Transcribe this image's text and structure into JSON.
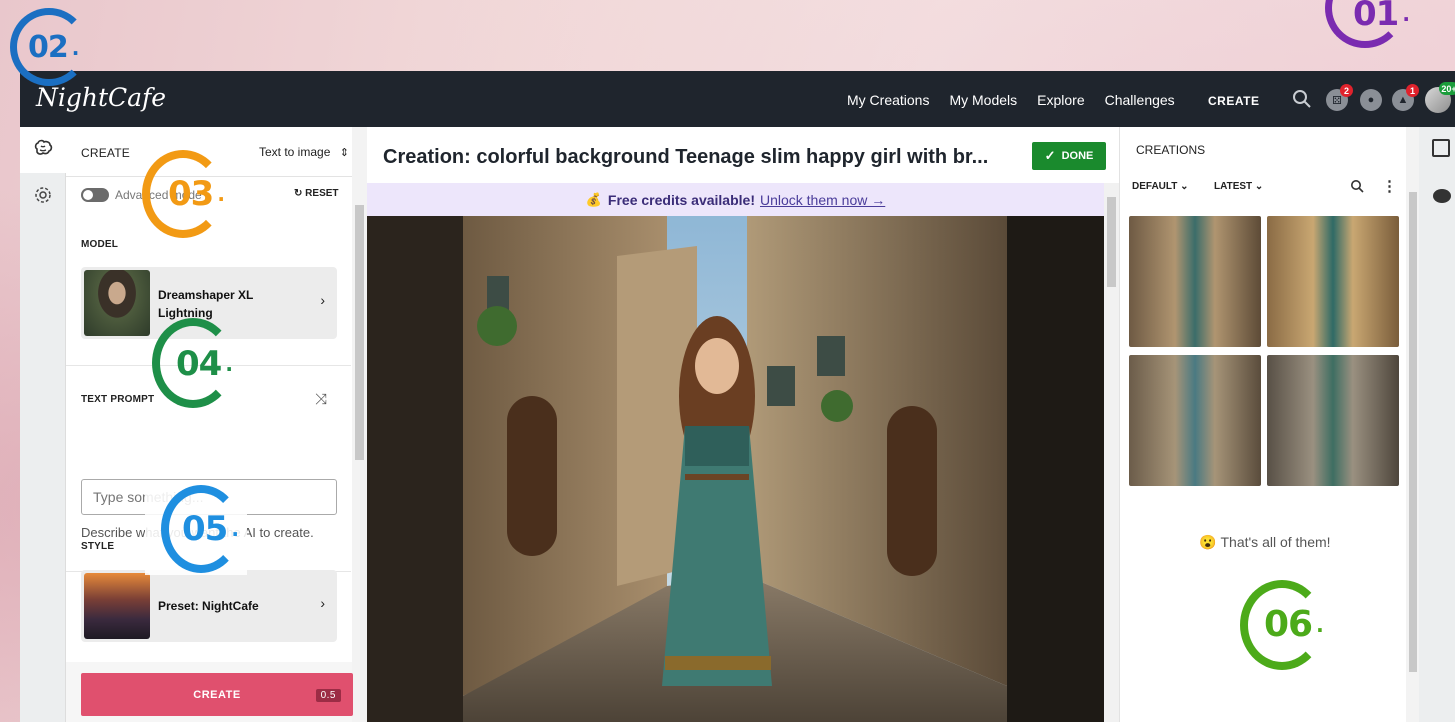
{
  "badges": [
    {
      "number": "02",
      "dot": ".",
      "color": "#1b6fc2"
    },
    {
      "number": "01",
      "dot": ".",
      "color": "#7a2bb0"
    },
    {
      "number": "03",
      "dot": ".",
      "color": "#f29a14"
    },
    {
      "number": "04",
      "dot": ".",
      "color": "#1e8f48"
    },
    {
      "number": "05",
      "dot": ".",
      "color": "#1f8fe0"
    },
    {
      "number": "06",
      "dot": ".",
      "color": "#4caa1a"
    }
  ],
  "topbar": {
    "logo": "NightCafe",
    "nav": [
      "My Creations",
      "My Models",
      "Explore",
      "Challenges"
    ],
    "create_label": "CREATE",
    "icons": [
      "search-icon",
      "dice-icon",
      "chat-icon",
      "bell-icon",
      "avatar"
    ],
    "notif_dice": "2",
    "notif_bell": "1",
    "notif_avatar": "20+"
  },
  "left_panel": {
    "header_label": "CREATE",
    "mode_select": "Text to image",
    "advanced_mode": "Advanced mode",
    "reset": "RESET",
    "model_label": "MODEL",
    "model_name": "Dreamshaper XL Lightning",
    "prompt_label": "TEXT PROMPT",
    "prompt_placeholder": "Type something...",
    "prompt_desc": "Describe what you want the AI to create.",
    "style_label": "STYLE",
    "style_name": "Preset: NightCafe",
    "create_button": "CREATE",
    "create_cost": "0.5"
  },
  "center": {
    "title": "Creation: colorful background Teenage slim happy girl with br...",
    "done_button": "DONE",
    "banner_emoji": "💰",
    "banner_bold": "Free credits available!",
    "banner_link": "Unlock them now →"
  },
  "right_panel": {
    "header": "CREATIONS",
    "sort_default": "DEFAULT",
    "sort_latest": "LATEST",
    "end_emoji": "😮",
    "end_text": "That's all of them!"
  },
  "colors": {
    "topbar": "#1f252d",
    "create_button": "#e0506e",
    "done_button": "#1a8a2d",
    "banner": "#ede6fb"
  }
}
